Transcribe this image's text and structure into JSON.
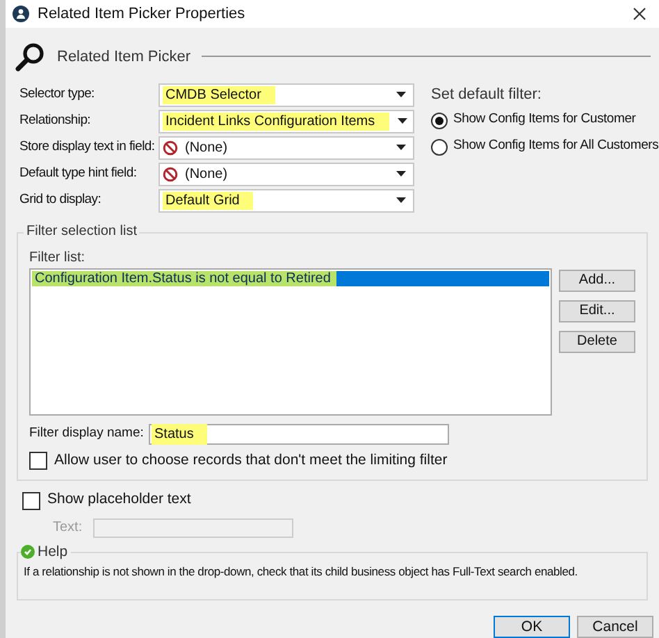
{
  "window": {
    "title": "Related Item Picker Properties"
  },
  "header": {
    "title": "Related Item Picker"
  },
  "fields": [
    {
      "label": "Selector type:",
      "value": "CMDB Selector",
      "none_icon": false,
      "highlighted": true
    },
    {
      "label": "Relationship:",
      "value": "Incident Links Configuration Items",
      "none_icon": false,
      "highlighted": true
    },
    {
      "label": "Store display text in field:",
      "value": "(None)",
      "none_icon": true,
      "highlighted": false
    },
    {
      "label": "Default type hint field:",
      "value": "(None)",
      "none_icon": true,
      "highlighted": false
    },
    {
      "label": "Grid to display:",
      "value": "Default Grid",
      "none_icon": false,
      "highlighted": true
    }
  ],
  "default_filter": {
    "label": "Set default filter:",
    "options": [
      {
        "label": "Show Config Items for Customer",
        "selected": true
      },
      {
        "label": "Show Config Items for All Customers",
        "selected": false
      }
    ]
  },
  "filter_group": {
    "title": "Filter selection list",
    "list_label": "Filter list:",
    "items": [
      {
        "text": "Configuration Item.Status is not equal to Retired",
        "selected": true,
        "highlighted": true
      }
    ],
    "buttons": [
      "Add...",
      "Edit...",
      "Delete"
    ],
    "display_name": {
      "label": "Filter display name:",
      "value": "Status",
      "highlighted": true
    },
    "allow": {
      "label": "Allow user to choose records that don't meet the limiting filter",
      "checked": false
    }
  },
  "placeholder": {
    "label": "Show placeholder text",
    "checked": false,
    "text_label": "Text:"
  },
  "help": {
    "title": "Help",
    "text": "If a relationship is not shown in the drop-down, check that its child business object has Full-Text search enabled."
  },
  "buttons": [
    {
      "label": "OK",
      "default": true
    },
    {
      "label": "Cancel",
      "default": false
    }
  ]
}
